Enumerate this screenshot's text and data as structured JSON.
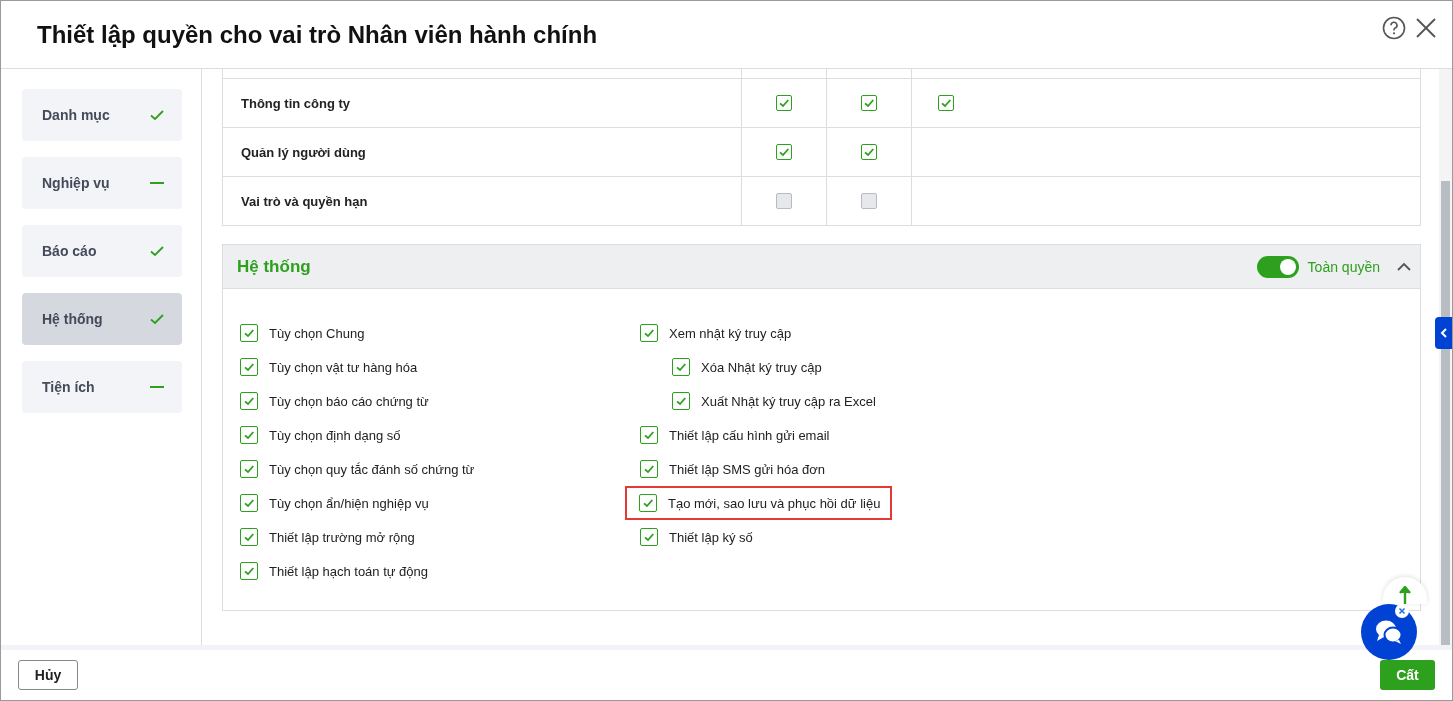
{
  "dialog": {
    "title": "Thiết lập quyền cho vai trò Nhân viên hành chính"
  },
  "sidebar": {
    "items": [
      {
        "label": "Danh mục",
        "complete": true,
        "selected": false
      },
      {
        "label": "Nghiệp vụ",
        "complete": false,
        "selected": false
      },
      {
        "label": "Báo cáo",
        "complete": true,
        "selected": false
      },
      {
        "label": "Hệ thống",
        "complete": true,
        "selected": true
      },
      {
        "label": "Tiện ích",
        "complete": false,
        "selected": false
      }
    ]
  },
  "table": {
    "rows": [
      {
        "name": "Thông tin công ty",
        "permissions": [
          {
            "checked": true
          },
          {
            "checked": true
          },
          {
            "checked": true
          }
        ]
      },
      {
        "name": "Quản lý người dùng",
        "permissions": [
          {
            "checked": true
          },
          {
            "checked": true
          }
        ]
      },
      {
        "name": "Vai trò và quyền hạn",
        "permissions": [
          {
            "checked": false
          },
          {
            "checked": false
          }
        ]
      }
    ]
  },
  "section": {
    "title": "Hệ thống",
    "full_access": {
      "label": "Toàn quyền",
      "on": true
    },
    "expanded": true,
    "columns": [
      [
        {
          "label": "Tùy chọn Chung",
          "checked": true,
          "highlighted": false
        },
        {
          "label": "Tùy chọn vật tư hàng hóa",
          "checked": true,
          "highlighted": false
        },
        {
          "label": "Tùy chọn báo cáo chứng từ",
          "checked": true,
          "highlighted": false
        },
        {
          "label": "Tùy chọn định dạng số",
          "checked": true,
          "highlighted": false
        },
        {
          "label": "Tùy chọn quy tắc đánh số chứng từ",
          "checked": true,
          "highlighted": false
        },
        {
          "label": "Tùy chọn ẩn/hiện nghiệp vụ",
          "checked": true,
          "highlighted": false
        },
        {
          "label": "Thiết lập trường mở rộng",
          "checked": true,
          "highlighted": false
        },
        {
          "label": "Thiết lập hạch toán tự động",
          "checked": true,
          "highlighted": false
        }
      ],
      [
        {
          "label": "Xem nhật ký truy cập",
          "checked": true,
          "highlighted": false,
          "children": [
            {
              "label": "Xóa Nhật ký truy cập",
              "checked": true
            },
            {
              "label": "Xuất Nhật ký truy cập ra Excel",
              "checked": true
            }
          ]
        },
        {
          "label": "Thiết lập cấu hình gửi email",
          "checked": true,
          "highlighted": false
        },
        {
          "label": "Thiết lập SMS gửi hóa đơn",
          "checked": true,
          "highlighted": false
        },
        {
          "label": "Tạo mới, sao lưu và phục hồi dữ liệu",
          "checked": true,
          "highlighted": true
        },
        {
          "label": "Thiết lập ký số",
          "checked": true,
          "highlighted": false
        }
      ]
    ]
  },
  "footer": {
    "cancel": "Hủy",
    "save": "Cất"
  }
}
